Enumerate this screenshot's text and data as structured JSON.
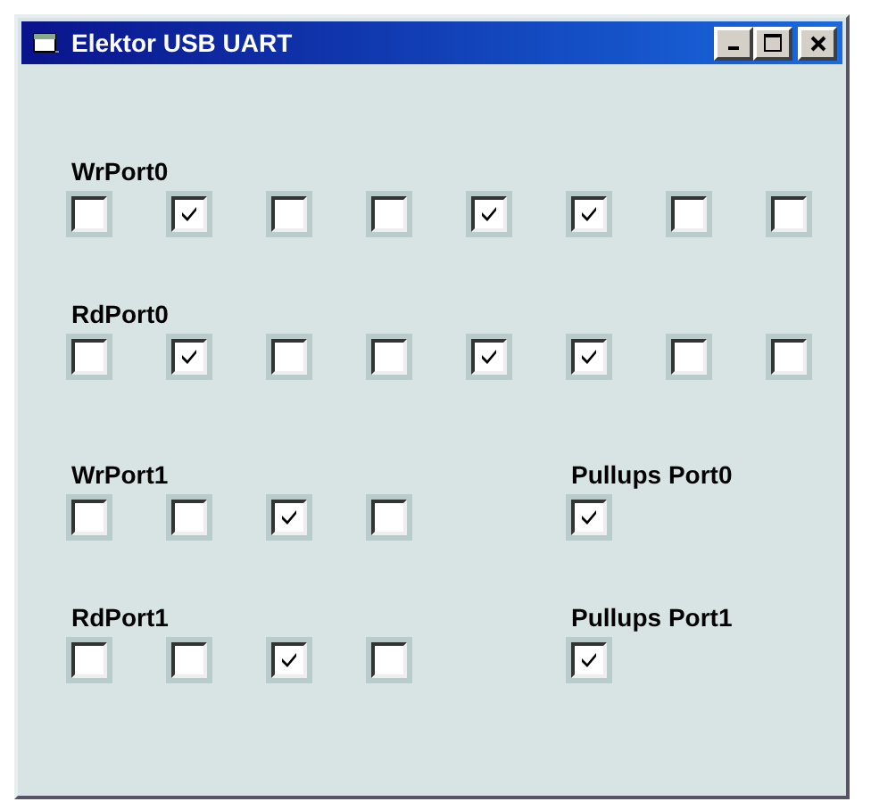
{
  "window": {
    "title": "Elektor USB UART"
  },
  "top_groups": [
    {
      "label": "WrPort0",
      "bits": [
        {
          "checked": false
        },
        {
          "checked": true
        },
        {
          "checked": false
        },
        {
          "checked": false
        },
        {
          "checked": true
        },
        {
          "checked": true
        },
        {
          "checked": false
        },
        {
          "checked": false
        }
      ]
    },
    {
      "label": "RdPort0",
      "bits": [
        {
          "checked": false
        },
        {
          "checked": true
        },
        {
          "checked": false
        },
        {
          "checked": false
        },
        {
          "checked": true
        },
        {
          "checked": true
        },
        {
          "checked": false
        },
        {
          "checked": false
        }
      ]
    }
  ],
  "bottom_rows": [
    {
      "left": {
        "label": "WrPort1",
        "bits": [
          {
            "checked": false
          },
          {
            "checked": false
          },
          {
            "checked": true
          },
          {
            "checked": false
          }
        ]
      },
      "right": {
        "label": "Pullups Port0",
        "bits": [
          {
            "checked": true
          }
        ]
      }
    },
    {
      "left": {
        "label": "RdPort1",
        "bits": [
          {
            "checked": false
          },
          {
            "checked": false
          },
          {
            "checked": true
          },
          {
            "checked": false
          }
        ]
      },
      "right": {
        "label": "Pullups Port1",
        "bits": [
          {
            "checked": true
          }
        ]
      }
    }
  ]
}
